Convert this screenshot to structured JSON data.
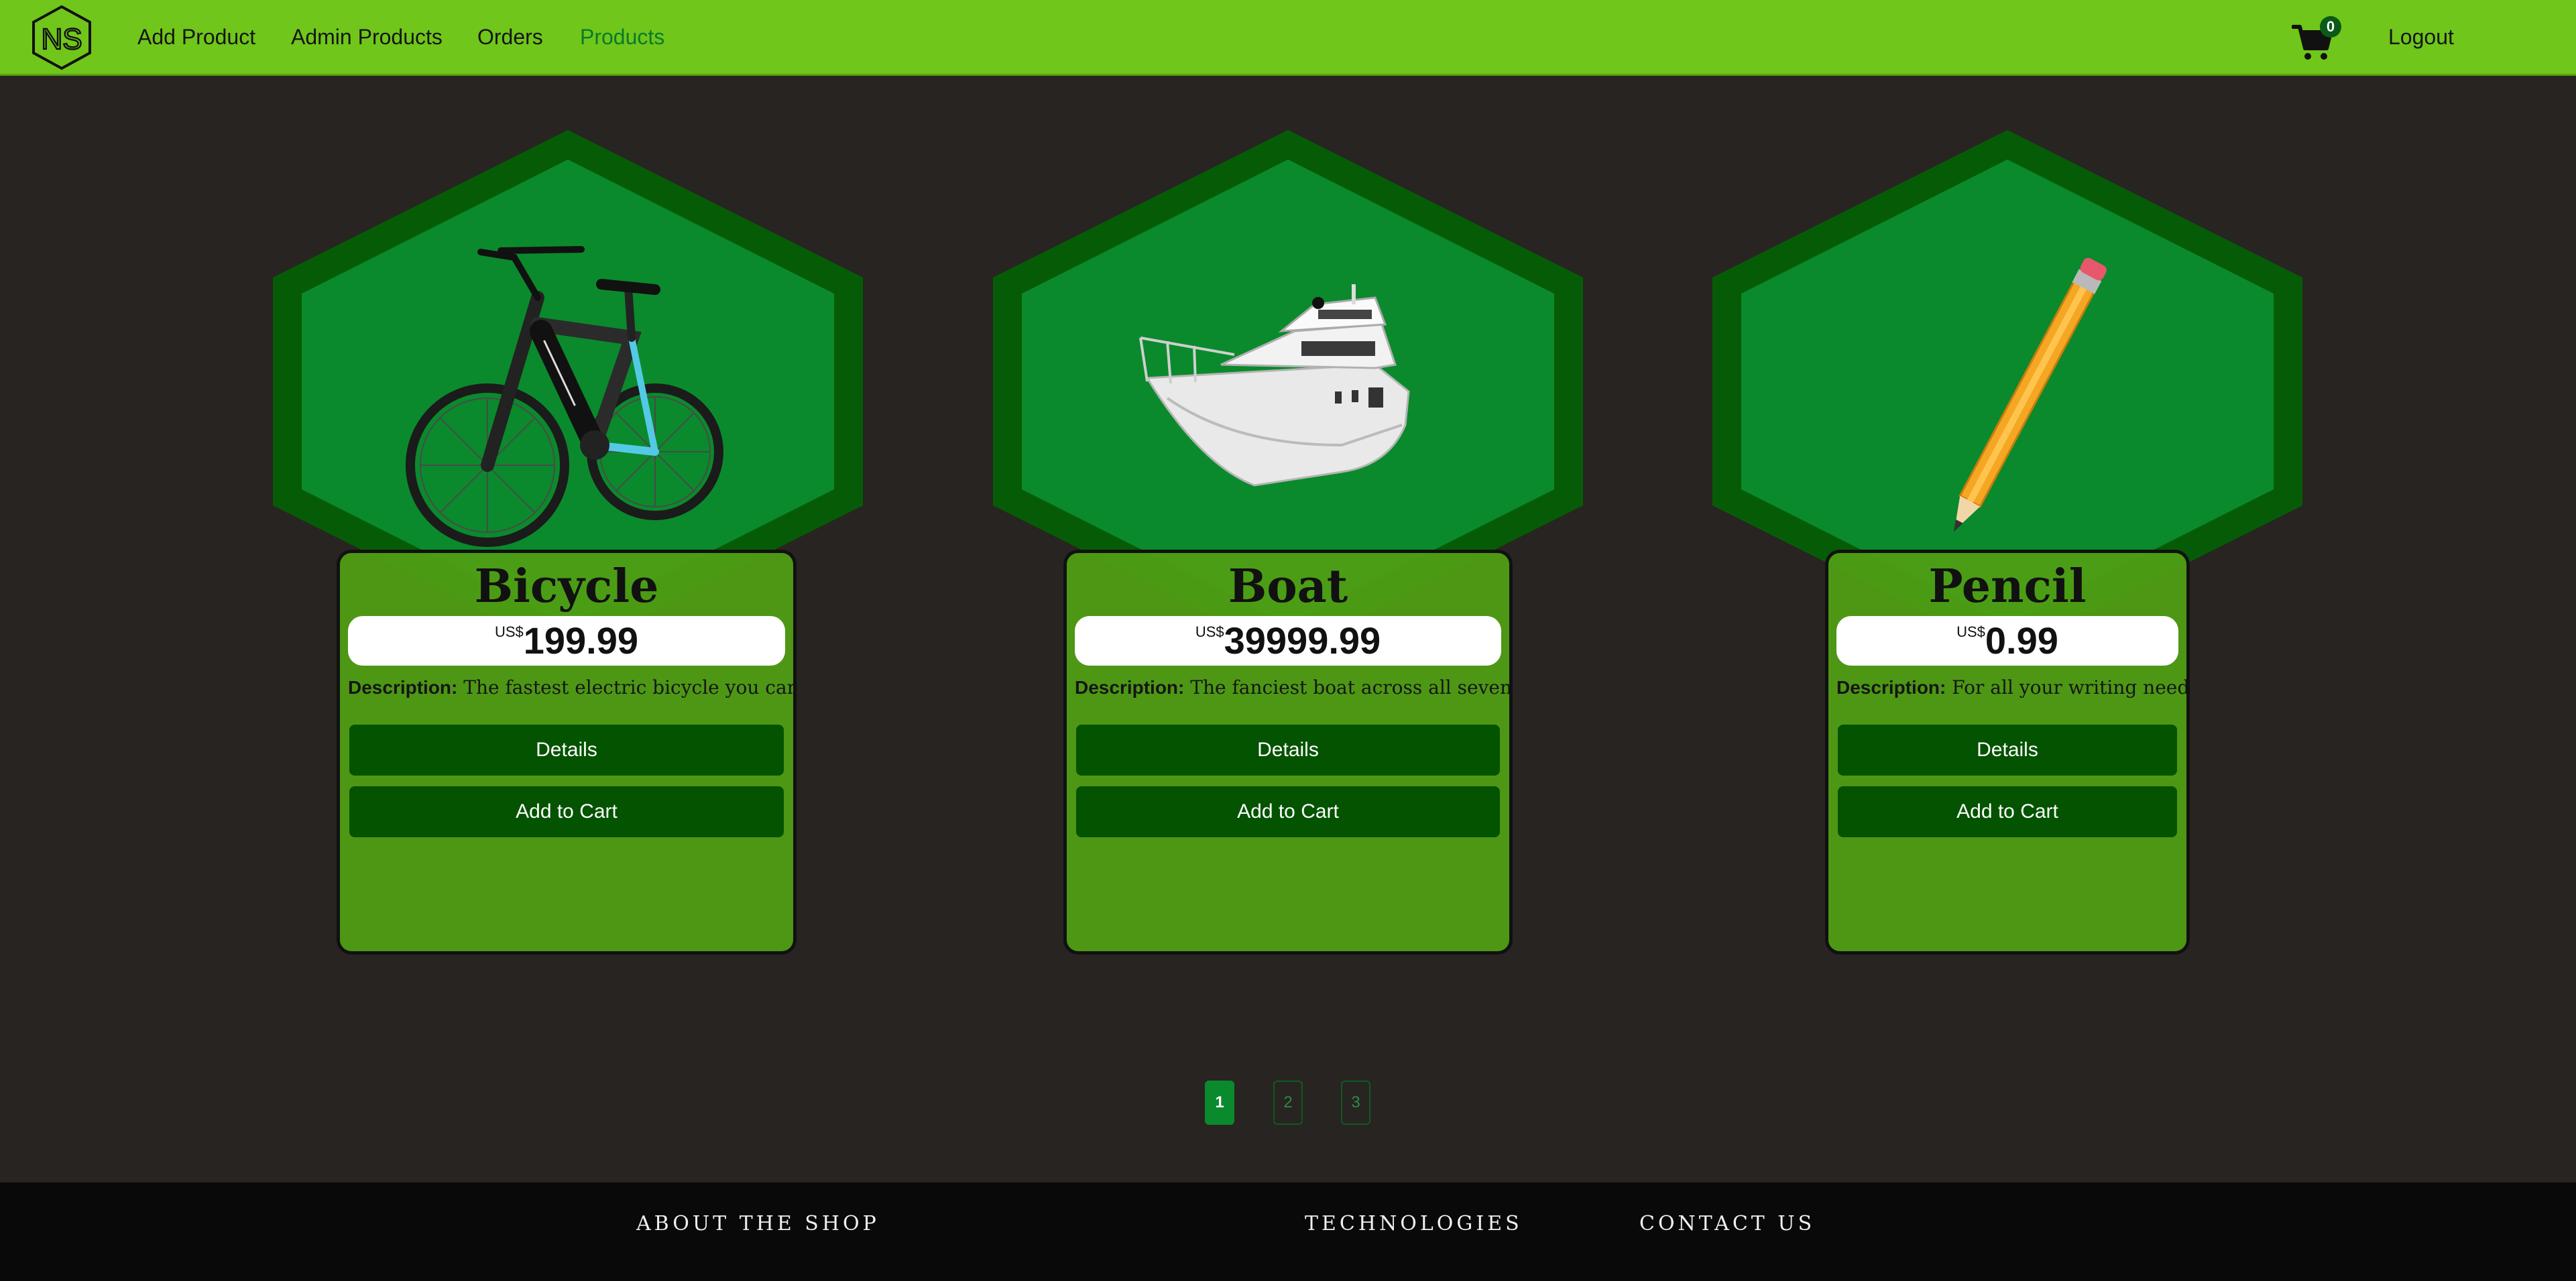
{
  "navbar": {
    "logo_text": "NS",
    "links": [
      {
        "label": "Add Product"
      },
      {
        "label": "Admin Products"
      },
      {
        "label": "Orders"
      },
      {
        "label": "Products"
      }
    ],
    "active_link": "Products",
    "cart_count": "0",
    "logout_label": "Logout"
  },
  "products": [
    {
      "title": "Bicycle",
      "currency": "US$",
      "price": "199.99",
      "description_label": "Description:",
      "description": "The fastest electric bicycle you can find!",
      "details_label": "Details",
      "add_to_cart_label": "Add to Cart",
      "image": "bicycle"
    },
    {
      "title": "Boat",
      "currency": "US$",
      "price": "39999.99",
      "description_label": "Description:",
      "description": "The fanciest boat across all seven seas.",
      "details_label": "Details",
      "add_to_cart_label": "Add to Cart",
      "image": "boat"
    },
    {
      "title": "Pencil",
      "currency": "US$",
      "price": "0.99",
      "description_label": "Description:",
      "description": "For all your writing needs.",
      "details_label": "Details",
      "add_to_cart_label": "Add to Cart",
      "image": "pencil"
    }
  ],
  "pagination": {
    "pages": [
      "1",
      "2",
      "3"
    ],
    "current": "1"
  },
  "footer": {
    "links": [
      {
        "label": "ABOUT THE SHOP"
      },
      {
        "label": "TECHNOLOGIES"
      },
      {
        "label": "CONTACT US"
      }
    ]
  },
  "colors": {
    "navbar_bg": "#70c61a",
    "page_bg": "#282422",
    "hex_outer": "#065c06",
    "hex_inner": "#0a8a2c",
    "card_bg": "#4b9a14",
    "button_bg": "#035300",
    "footer_bg": "#090909",
    "active_page": "#0a8a2c"
  }
}
